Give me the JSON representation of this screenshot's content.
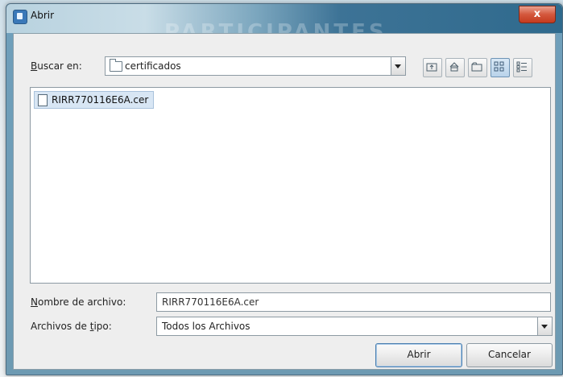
{
  "window": {
    "title": "Abrir",
    "background_watermark": "PARTICIPANTES",
    "close_label": "x"
  },
  "lookin": {
    "label_prefix": "B",
    "label_rest": "uscar en:",
    "value": "certificados"
  },
  "toolbar": {
    "buttons": [
      "up-folder-icon",
      "home-icon",
      "new-folder-icon",
      "list-view-icon",
      "details-view-icon"
    ]
  },
  "files": [
    {
      "name": "RIRR770116E6A.cer",
      "selected": true
    }
  ],
  "filename": {
    "label_prefix": "N",
    "label_rest": "ombre de archivo:",
    "value": "RIRR770116E6A.cer"
  },
  "filetype": {
    "label_head": "Archivos de ",
    "label_ul": "t",
    "label_tail": "ipo:",
    "value": "Todos los Archivos"
  },
  "buttons": {
    "open": "Abrir",
    "cancel": "Cancelar"
  }
}
